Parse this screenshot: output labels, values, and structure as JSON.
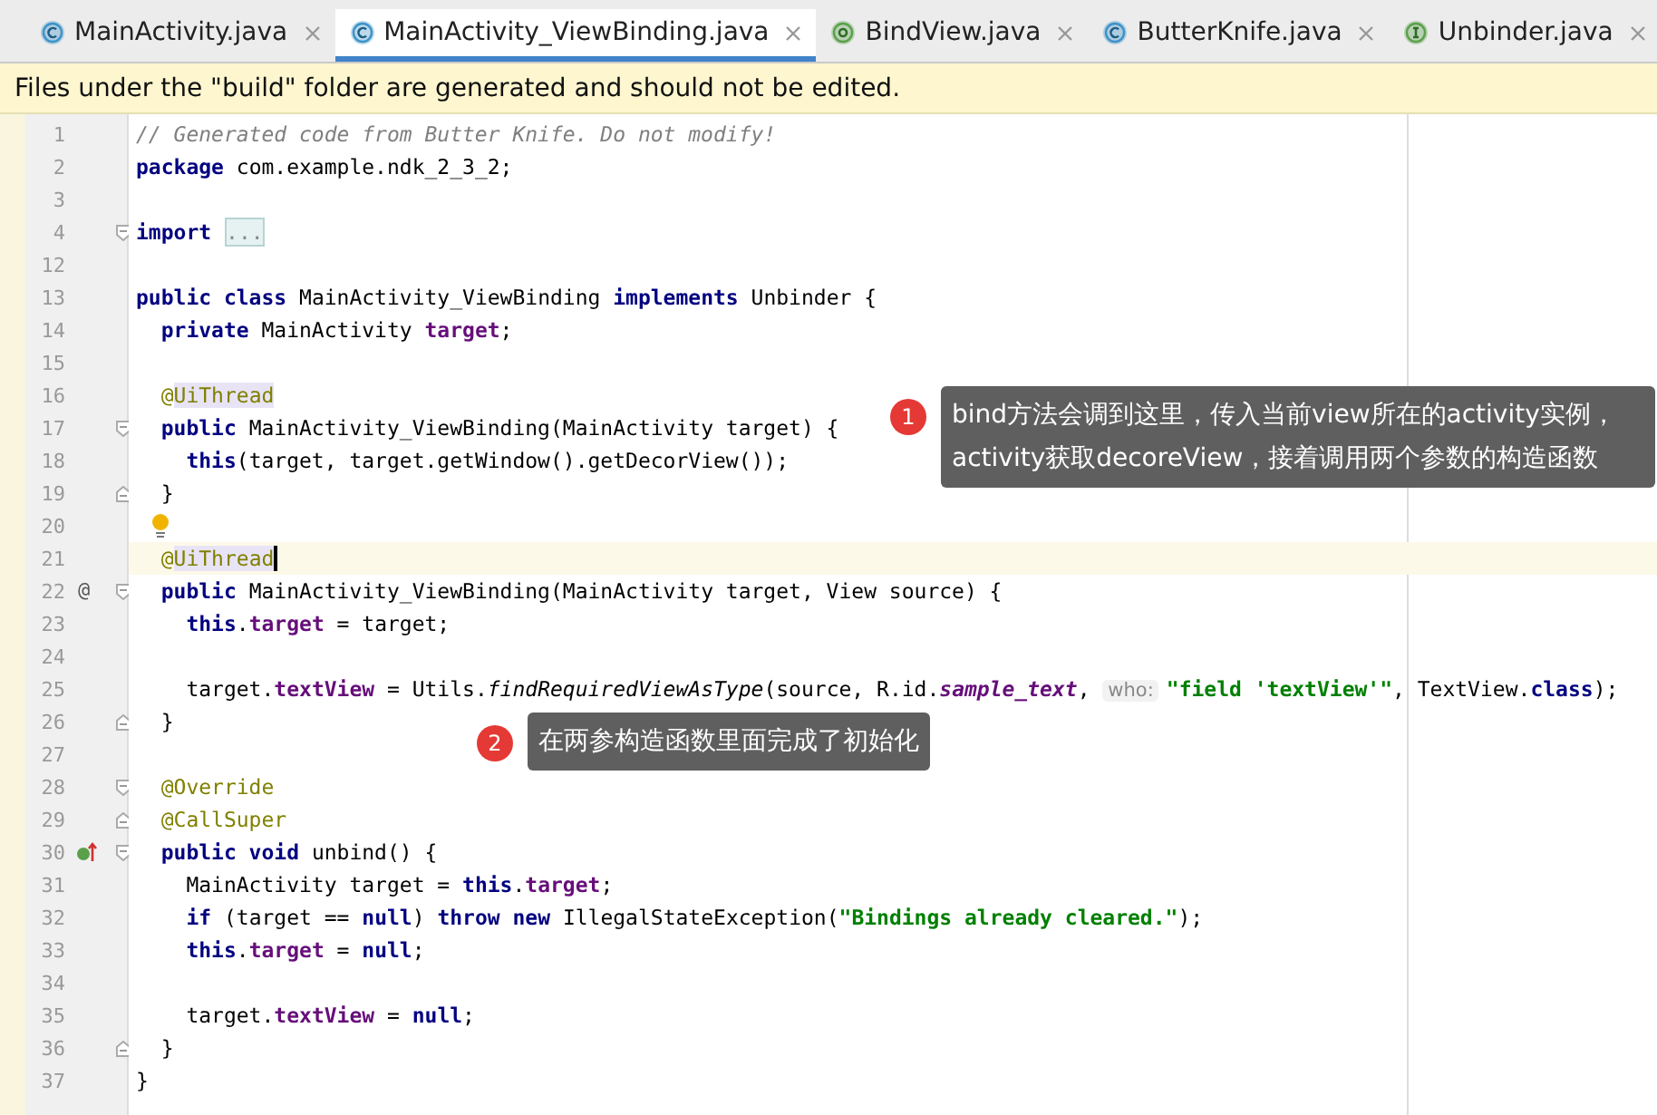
{
  "tabs": [
    {
      "label": "MainActivity.java",
      "kind": "class",
      "selected": false
    },
    {
      "label": "MainActivity_ViewBinding.java",
      "kind": "class",
      "selected": true
    },
    {
      "label": "BindView.java",
      "kind": "annotation",
      "selected": false
    },
    {
      "label": "ButterKnife.java",
      "kind": "class",
      "selected": false
    },
    {
      "label": "Unbinder.java",
      "kind": "interface",
      "selected": false
    }
  ],
  "banner": "Files under the \"build\" folder are generated and should not be edited.",
  "lines": [
    {
      "number": "1",
      "current": false,
      "tokens": [
        {
          "kind": "comment",
          "t": "// Generated code from Butter Knife. Do not modify!"
        }
      ]
    },
    {
      "number": "2",
      "current": false,
      "tokens": [
        {
          "kind": "kw",
          "t": "package"
        },
        {
          "kind": "plain",
          "t": " com.example.ndk_2_3_2;"
        }
      ]
    },
    {
      "number": "3",
      "current": false
    },
    {
      "number": "4",
      "current": false,
      "fold": {
        "kind": "open"
      },
      "tokens": [
        {
          "kind": "kw",
          "t": "import"
        },
        {
          "kind": "folded",
          "t": "..."
        }
      ]
    },
    {
      "number": "12",
      "current": false
    },
    {
      "number": "13",
      "current": false,
      "tokens": [
        {
          "kind": "kw",
          "t": "public class"
        },
        {
          "kind": "plain",
          "t": " MainActivity_ViewBinding "
        },
        {
          "kind": "kw",
          "t": "implements"
        },
        {
          "kind": "plain",
          "t": " Unbinder {"
        }
      ]
    },
    {
      "number": "14",
      "current": false,
      "tokens": [
        {
          "kind": "kw",
          "t": "  private"
        },
        {
          "kind": "plain",
          "t": " MainActivity "
        },
        {
          "kind": "field",
          "t": "target"
        },
        {
          "kind": "plain",
          "t": ";"
        }
      ]
    },
    {
      "number": "15",
      "current": false
    },
    {
      "number": "16",
      "current": false,
      "tokens": [
        {
          "kind": "ann",
          "t": "  @"
        },
        {
          "kind": "annhl",
          "t": "UiThread"
        }
      ]
    },
    {
      "number": "17",
      "current": false,
      "fold": {
        "kind": "open"
      },
      "tokens": [
        {
          "kind": "kw",
          "t": "  public"
        },
        {
          "kind": "plain",
          "t": " MainActivity_ViewBinding(MainActivity target) {"
        }
      ]
    },
    {
      "number": "18",
      "current": false,
      "tokens": [
        {
          "kind": "kw",
          "t": "    this"
        },
        {
          "kind": "plain",
          "t": "(target, target.getWindow().getDecorView());"
        }
      ]
    },
    {
      "number": "19",
      "current": false,
      "fold": {
        "kind": "close"
      },
      "tokens": [
        {
          "kind": "plain",
          "t": "  }"
        }
      ]
    },
    {
      "number": "20",
      "current": false,
      "bulb": true
    },
    {
      "number": "21",
      "current": true,
      "tokens": [
        {
          "kind": "ann",
          "t": "  @"
        },
        {
          "kind": "annhl",
          "t": "UiThread"
        }
      ]
    },
    {
      "number": "22",
      "current": false,
      "gutter": "@",
      "fold": {
        "kind": "open"
      },
      "tokens": [
        {
          "kind": "kw",
          "t": "  public"
        },
        {
          "kind": "plain",
          "t": " MainActivity_ViewBinding(MainActivity target, View source) {"
        }
      ]
    },
    {
      "number": "23",
      "current": false,
      "tokens": [
        {
          "kind": "kw",
          "t": "    this"
        },
        {
          "kind": "plain",
          "t": "."
        },
        {
          "kind": "field",
          "t": "target"
        },
        {
          "kind": "plain",
          "t": " = target;"
        }
      ]
    },
    {
      "number": "24",
      "current": false
    },
    {
      "number": "25",
      "current": false,
      "tokens": [
        {
          "kind": "plain",
          "t": "    target."
        },
        {
          "kind": "field",
          "t": "textView"
        },
        {
          "kind": "plain",
          "t": " = Utils."
        },
        {
          "kind": "italic",
          "t": "findRequiredViewAsType"
        },
        {
          "kind": "plain",
          "t": "(source, R.id."
        },
        {
          "kind": "static",
          "t": "sample_text"
        },
        {
          "kind": "plain",
          "t": ", "
        },
        {
          "kind": "hint",
          "t": "who:"
        },
        {
          "kind": "str",
          "t": "\"field 'textView'\""
        },
        {
          "kind": "plain",
          "t": ", TextView."
        },
        {
          "kind": "kw",
          "t": "class"
        },
        {
          "kind": "plain",
          "t": ");"
        }
      ]
    },
    {
      "number": "26",
      "current": false,
      "fold": {
        "kind": "close"
      },
      "tokens": [
        {
          "kind": "plain",
          "t": "  }"
        }
      ]
    },
    {
      "number": "27",
      "current": false
    },
    {
      "number": "28",
      "current": false,
      "fold": {
        "kind": "open"
      },
      "tokens": [
        {
          "kind": "ann",
          "t": "  @Override"
        }
      ]
    },
    {
      "number": "29",
      "current": false,
      "fold": {
        "kind": "close"
      },
      "tokens": [
        {
          "kind": "ann",
          "t": "  @CallSuper"
        }
      ]
    },
    {
      "number": "30",
      "current": false,
      "gutter_icon": {
        "kind": "implements"
      },
      "fold": {
        "kind": "open"
      },
      "tokens": [
        {
          "kind": "kw",
          "t": "  public void"
        },
        {
          "kind": "plain",
          "t": " unbind() {"
        }
      ]
    },
    {
      "number": "31",
      "current": false,
      "tokens": [
        {
          "kind": "plain",
          "t": "    MainActivity target = "
        },
        {
          "kind": "kw",
          "t": "this"
        },
        {
          "kind": "plain",
          "t": "."
        },
        {
          "kind": "field",
          "t": "target"
        },
        {
          "kind": "plain",
          "t": ";"
        }
      ]
    },
    {
      "number": "32",
      "current": false,
      "tokens": [
        {
          "kind": "kw",
          "t": "    if"
        },
        {
          "kind": "plain",
          "t": " (target == "
        },
        {
          "kind": "kw",
          "t": "null"
        },
        {
          "kind": "plain",
          "t": ") "
        },
        {
          "kind": "kw",
          "t": "throw new"
        },
        {
          "kind": "plain",
          "t": " IllegalStateException("
        },
        {
          "kind": "str",
          "t": "\"Bindings already cleared.\""
        },
        {
          "kind": "plain",
          "t": ");"
        }
      ]
    },
    {
      "number": "33",
      "current": false,
      "tokens": [
        {
          "kind": "kw",
          "t": "    this"
        },
        {
          "kind": "plain",
          "t": "."
        },
        {
          "kind": "field",
          "t": "target"
        },
        {
          "kind": "plain",
          "t": " = "
        },
        {
          "kind": "kw",
          "t": "null"
        },
        {
          "kind": "plain",
          "t": ";"
        }
      ]
    },
    {
      "number": "34",
      "current": false
    },
    {
      "number": "35",
      "current": false,
      "tokens": [
        {
          "kind": "plain",
          "t": "    target."
        },
        {
          "kind": "field",
          "t": "textView"
        },
        {
          "kind": "plain",
          "t": " = "
        },
        {
          "kind": "kw",
          "t": "null"
        },
        {
          "kind": "plain",
          "t": ";"
        }
      ]
    },
    {
      "number": "36",
      "current": false,
      "fold": {
        "kind": "close"
      },
      "tokens": [
        {
          "kind": "plain",
          "t": "  }"
        }
      ]
    },
    {
      "number": "37",
      "current": false,
      "tokens": [
        {
          "kind": "plain",
          "t": "}"
        }
      ]
    }
  ],
  "callouts": [
    {
      "badge": "1",
      "text": "bind方法会调到这里，传入当前view所在的activity实例，activity获取decoreView，接着调用两个参数的构造函数"
    },
    {
      "badge": "2",
      "text": "在两参构造函数里面完成了初始化"
    }
  ]
}
